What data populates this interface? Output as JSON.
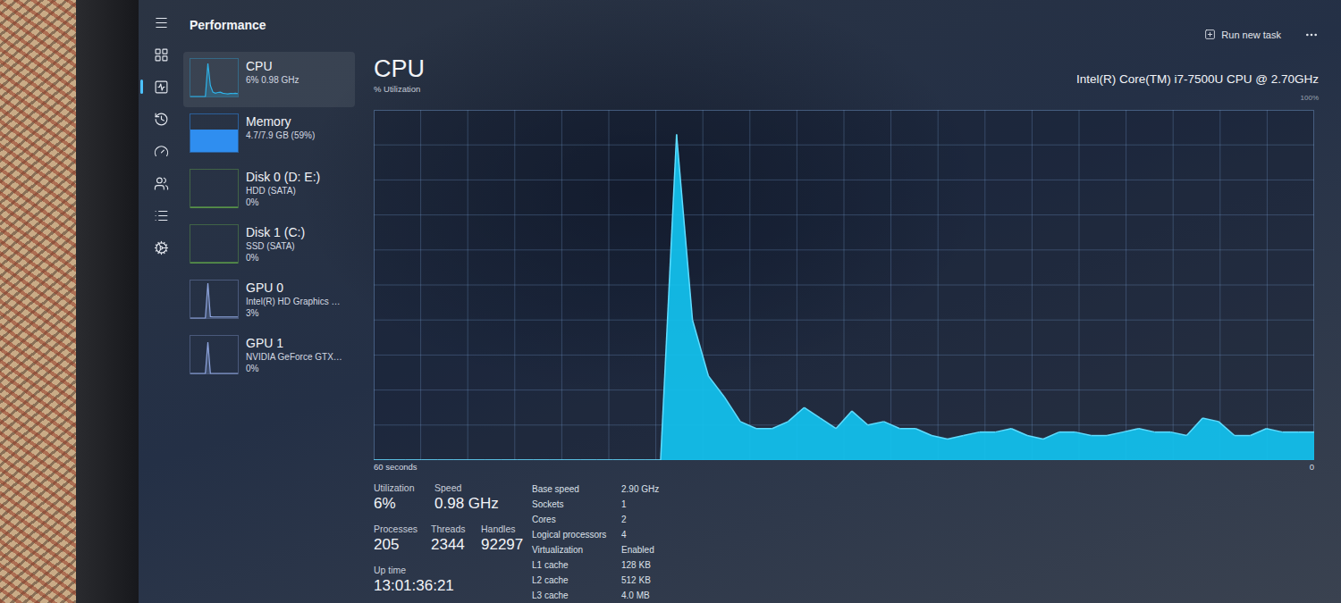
{
  "nav": [
    {
      "selected": false
    },
    {
      "selected": false
    },
    {
      "selected": true
    },
    {
      "selected": false
    },
    {
      "selected": false
    },
    {
      "selected": false
    },
    {
      "selected": false
    },
    {
      "selected": false
    }
  ],
  "page": {
    "title": "Performance"
  },
  "toolbar": {
    "run_new_task": "Run new task"
  },
  "sidebar": {
    "items": [
      {
        "name": "CPU",
        "details": [
          "6% 0.98 GHz"
        ],
        "selected": true,
        "kind": "line",
        "color": "#2fb2e8",
        "graph": [
          0,
          0,
          0,
          0,
          0,
          0,
          0,
          90,
          30,
          12,
          9,
          11,
          12,
          9,
          8,
          7,
          8,
          8,
          9,
          8
        ]
      },
      {
        "name": "Memory",
        "details": [
          "4.7/7.9 GB (59%)"
        ],
        "selected": false,
        "kind": "fill",
        "color": "#2f8ef0",
        "level": 0.59
      },
      {
        "name": "Disk 0 (D: E:)",
        "details": [
          "HDD (SATA)",
          "0%"
        ],
        "selected": false,
        "kind": "line",
        "color": "#6fbf4a",
        "graph": [
          0,
          0,
          0,
          0,
          0,
          0,
          0,
          0,
          0,
          0,
          0,
          0,
          0,
          0,
          0,
          0,
          0,
          0,
          0,
          0
        ]
      },
      {
        "name": "Disk 1 (C:)",
        "details": [
          "SSD (SATA)",
          "0%"
        ],
        "selected": false,
        "kind": "line",
        "color": "#6fbf4a",
        "graph": [
          0,
          0,
          0,
          0,
          0,
          0,
          0,
          0,
          0,
          0,
          0,
          0,
          0,
          0,
          0,
          0,
          0,
          0,
          0,
          0
        ]
      },
      {
        "name": "GPU 0",
        "details": [
          "Intel(R) HD Graphics …",
          "3%"
        ],
        "selected": false,
        "kind": "line",
        "color": "#8fa6e0",
        "graph": [
          0,
          0,
          0,
          0,
          0,
          0,
          0,
          95,
          4,
          3,
          3,
          3,
          3,
          3,
          3,
          3,
          3,
          3,
          3,
          3
        ]
      },
      {
        "name": "GPU 1",
        "details": [
          "NVIDIA GeForce GTX…",
          "0%"
        ],
        "selected": false,
        "kind": "line",
        "color": "#8fa6e0",
        "graph": [
          0,
          0,
          0,
          0,
          0,
          0,
          0,
          85,
          0,
          0,
          0,
          0,
          0,
          0,
          0,
          0,
          0,
          0,
          0,
          0
        ]
      }
    ]
  },
  "main": {
    "title": "CPU",
    "subtitle": "% Utilization",
    "device": "Intel(R) Core(TM) i7-7500U CPU @ 2.70GHz",
    "y_max": "100%",
    "x_label": "60 seconds",
    "y_min": "0"
  },
  "chart": {
    "series": [
      {
        "values": [
          0,
          0,
          0,
          0,
          0,
          0,
          0,
          0,
          0,
          0,
          0,
          0,
          0,
          0,
          0,
          0,
          0,
          0,
          0,
          93,
          40,
          24,
          18,
          11,
          9,
          9,
          11,
          15,
          12,
          9,
          14,
          10,
          11,
          9,
          9,
          7,
          6,
          7,
          8,
          8,
          9,
          7,
          6,
          8,
          8,
          7,
          7,
          8,
          9,
          8,
          8,
          7,
          12,
          11,
          7,
          7,
          9,
          8,
          8,
          8
        ]
      }
    ]
  },
  "stats": {
    "primary": [
      [
        {
          "label": "Utilization",
          "value": "6%"
        },
        {
          "label": "Speed",
          "value": "0.98 GHz"
        }
      ],
      [
        {
          "label": "Processes",
          "value": "205"
        },
        {
          "label": "Threads",
          "value": "2344"
        },
        {
          "label": "Handles",
          "value": "92297"
        }
      ],
      [
        {
          "label": "Up time",
          "value": "13:01:36:21"
        }
      ]
    ],
    "details": [
      {
        "label": "Base speed",
        "value": "2.90 GHz"
      },
      {
        "label": "Sockets",
        "value": "1"
      },
      {
        "label": "Cores",
        "value": "2"
      },
      {
        "label": "Logical processors",
        "value": "4"
      },
      {
        "label": "Virtualization",
        "value": "Enabled"
      },
      {
        "label": "L1 cache",
        "value": "128 KB"
      },
      {
        "label": "L2 cache",
        "value": "512 KB"
      },
      {
        "label": "L3 cache",
        "value": "4.0 MB"
      }
    ]
  }
}
